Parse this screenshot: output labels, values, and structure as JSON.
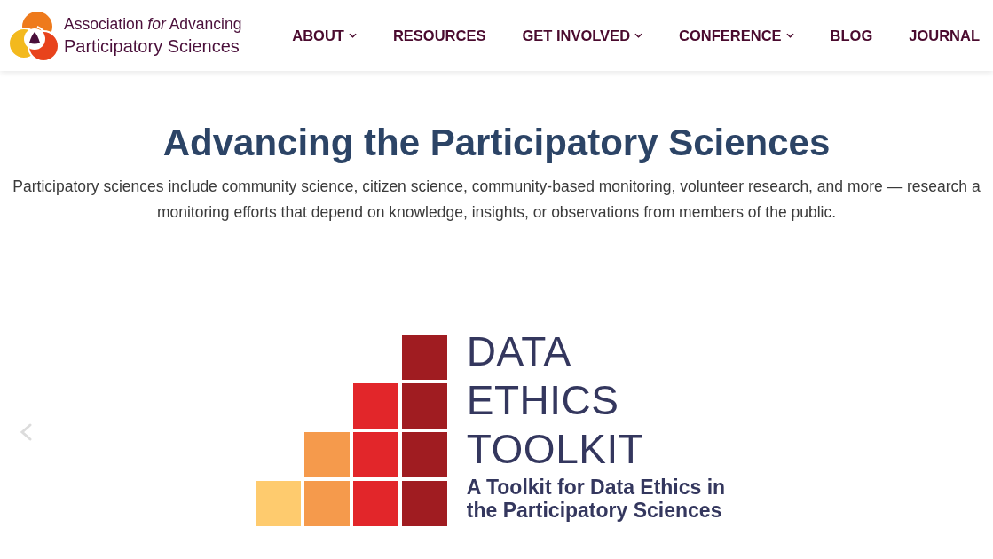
{
  "header": {
    "logo": {
      "line_1": "Association *for* Advancing",
      "line_2": "Participatory Sciences"
    },
    "nav": [
      {
        "label": "ABOUT",
        "has_dropdown": true
      },
      {
        "label": "RESOURCES",
        "has_dropdown": false
      },
      {
        "label": "GET INVOLVED",
        "has_dropdown": true
      },
      {
        "label": "CONFERENCE",
        "has_dropdown": true
      },
      {
        "label": "BLOG",
        "has_dropdown": false
      },
      {
        "label": "JOURNAL",
        "has_dropdown": false
      }
    ]
  },
  "hero": {
    "title": "Advancing the Participatory Sciences",
    "description_lines": [
      "Participatory sciences include community science, citizen science, community-based monitoring, volunteer research, and more — research a",
      "monitoring efforts that depend on knowledge, insights, or observations from members of the public."
    ]
  },
  "carousel": {
    "slide": {
      "title": "DATA ETHICS TOOLKIT",
      "subtitle_lines": [
        "A Toolkit for Data Ethics in",
        "the Participatory Sciences"
      ]
    }
  }
}
